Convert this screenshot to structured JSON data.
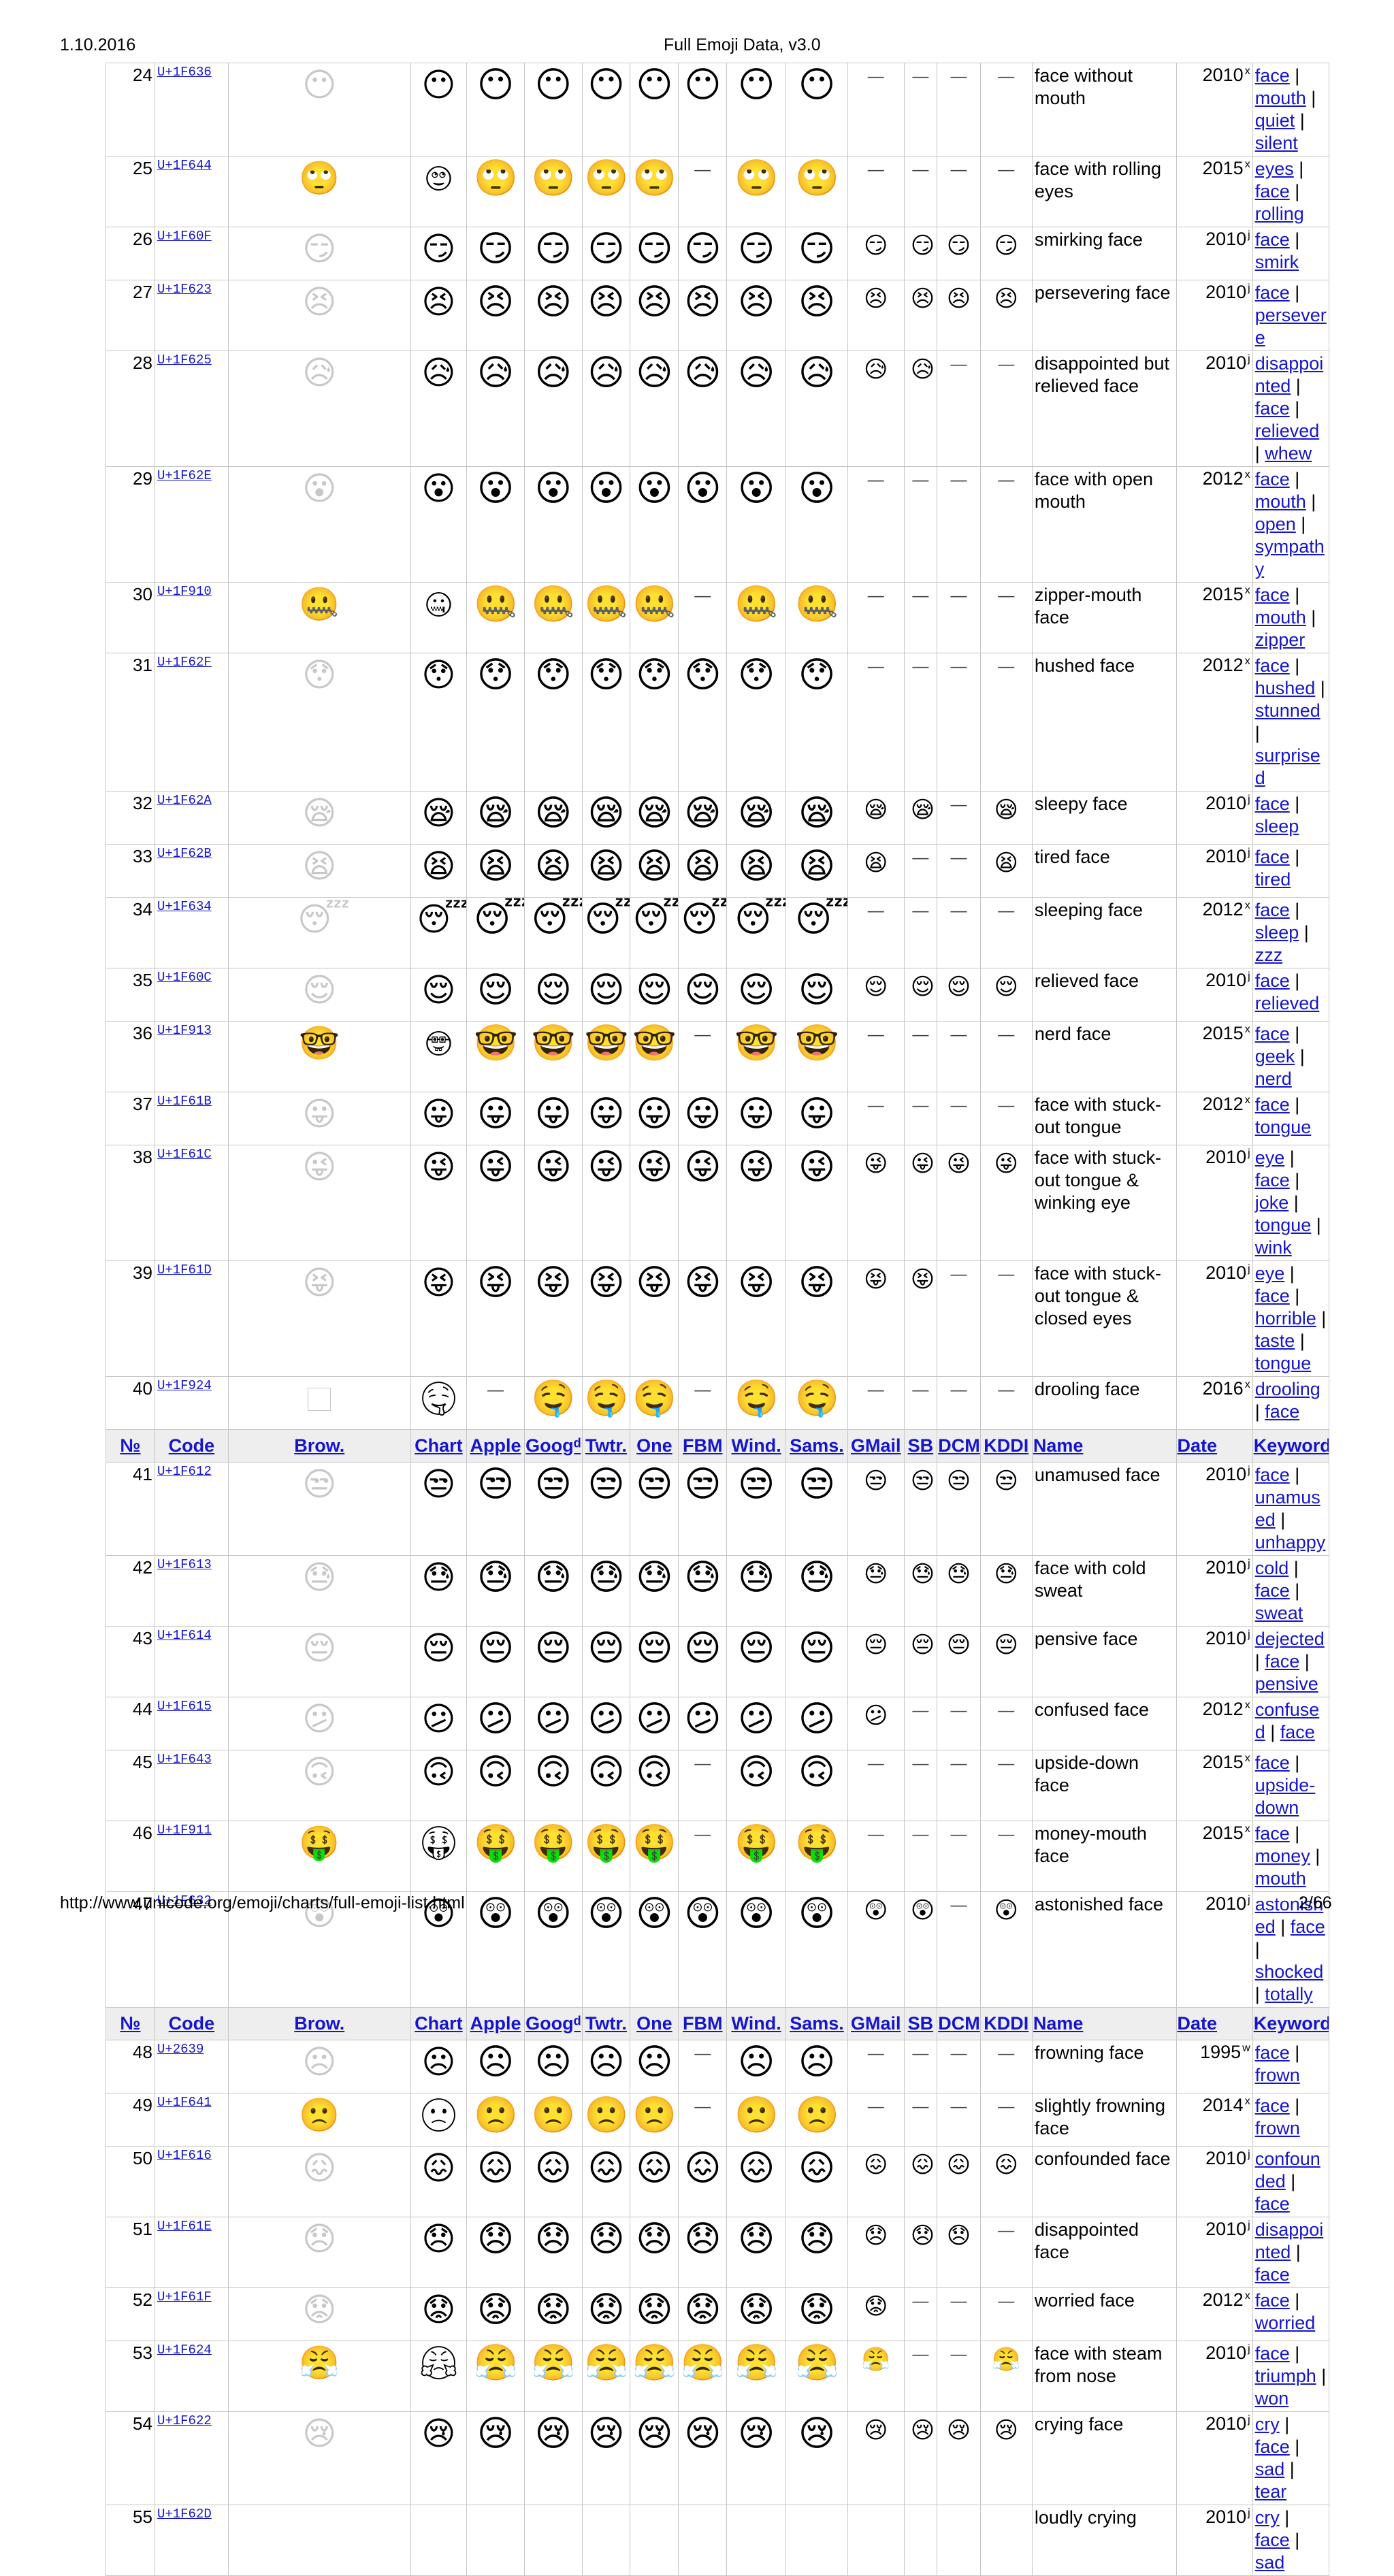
{
  "header": {
    "date": "1.10.2016",
    "title": "Full Emoji Data, v3.0"
  },
  "footer": {
    "url": "http://www.unicode.org/emoji/charts/full-emoji-list.html",
    "page": "2/66"
  },
  "columns": [
    "№",
    "Code",
    "Brow.",
    "Chart",
    "Apple",
    "Googᵈ",
    "Twtr.",
    "One",
    "FBM",
    "Wind.",
    "Sams.",
    "GMail",
    "SB",
    "DCM",
    "KDDI",
    "Name",
    "Date",
    "Keywords"
  ],
  "rows": [
    {
      "type": "emoji",
      "num": "24",
      "code": "U+1F636",
      "glyph": "😶",
      "g": [
        1,
        1,
        1,
        1,
        1,
        1,
        1,
        0,
        0,
        0,
        0
      ],
      "name": "face without mouth",
      "date": "2010",
      "dsup": "x",
      "kw": [
        "face",
        "mouth",
        "quiet",
        "silent"
      ]
    },
    {
      "type": "emoji",
      "num": "25",
      "code": "U+1F644",
      "glyph": "🙄",
      "g": [
        1,
        1,
        1,
        1,
        0,
        1,
        1,
        0,
        0,
        0,
        0
      ],
      "name": "face with rolling eyes",
      "date": "2015",
      "dsup": "x",
      "kw": [
        "eyes",
        "face",
        "rolling"
      ]
    },
    {
      "type": "emoji",
      "num": "26",
      "code": "U+1F60F",
      "glyph": "😏",
      "g": [
        1,
        1,
        1,
        1,
        1,
        1,
        1,
        1,
        1,
        1,
        1
      ],
      "name": "smirking face",
      "date": "2010",
      "dsup": "j",
      "kw": [
        "face",
        "smirk"
      ]
    },
    {
      "type": "emoji",
      "num": "27",
      "code": "U+1F623",
      "glyph": "😣",
      "g": [
        1,
        1,
        1,
        1,
        1,
        1,
        1,
        1,
        1,
        1,
        1
      ],
      "name": "persevering face",
      "date": "2010",
      "dsup": "j",
      "kw": [
        "face",
        "persevere"
      ]
    },
    {
      "type": "emoji",
      "num": "28",
      "code": "U+1F625",
      "glyph": "😥",
      "g": [
        1,
        1,
        1,
        1,
        1,
        1,
        1,
        1,
        1,
        0,
        0
      ],
      "name": "disappointed but relieved face",
      "date": "2010",
      "dsup": "j",
      "kw": [
        "disappointed",
        "face",
        "relieved",
        "whew"
      ]
    },
    {
      "type": "emoji",
      "num": "29",
      "code": "U+1F62E",
      "glyph": "😮",
      "g": [
        1,
        1,
        1,
        1,
        1,
        1,
        1,
        0,
        0,
        0,
        0
      ],
      "name": "face with open mouth",
      "date": "2012",
      "dsup": "x",
      "kw": [
        "face",
        "mouth",
        "open",
        "sympathy"
      ]
    },
    {
      "type": "emoji",
      "num": "30",
      "code": "U+1F910",
      "glyph": "🤐",
      "g": [
        1,
        1,
        1,
        1,
        0,
        1,
        1,
        0,
        0,
        0,
        0
      ],
      "name": "zipper-mouth face",
      "date": "2015",
      "dsup": "x",
      "kw": [
        "face",
        "mouth",
        "zipper"
      ]
    },
    {
      "type": "emoji",
      "num": "31",
      "code": "U+1F62F",
      "glyph": "😯",
      "g": [
        1,
        1,
        1,
        1,
        1,
        1,
        1,
        0,
        0,
        0,
        0
      ],
      "name": "hushed face",
      "date": "2012",
      "dsup": "x",
      "kw": [
        "face",
        "hushed",
        "stunned",
        "surprised"
      ]
    },
    {
      "type": "emoji",
      "num": "32",
      "code": "U+1F62A",
      "glyph": "😪",
      "g": [
        1,
        1,
        1,
        1,
        1,
        1,
        1,
        1,
        1,
        0,
        1
      ],
      "name": "sleepy face",
      "date": "2010",
      "dsup": "j",
      "kw": [
        "face",
        "sleep"
      ]
    },
    {
      "type": "emoji",
      "num": "33",
      "code": "U+1F62B",
      "glyph": "😫",
      "g": [
        1,
        1,
        1,
        1,
        1,
        1,
        1,
        1,
        0,
        0,
        1
      ],
      "name": "tired face",
      "date": "2010",
      "dsup": "j",
      "kw": [
        "face",
        "tired"
      ]
    },
    {
      "type": "emoji",
      "num": "34",
      "code": "U+1F634",
      "glyph": "😴",
      "g": [
        1,
        1,
        1,
        1,
        1,
        1,
        1,
        0,
        0,
        0,
        0
      ],
      "name": "sleeping face",
      "date": "2012",
      "dsup": "x",
      "kw": [
        "face",
        "sleep",
        "zzz"
      ]
    },
    {
      "type": "emoji",
      "num": "35",
      "code": "U+1F60C",
      "glyph": "😌",
      "g": [
        1,
        1,
        1,
        1,
        1,
        1,
        1,
        1,
        1,
        1,
        1
      ],
      "name": "relieved face",
      "date": "2010",
      "dsup": "j",
      "kw": [
        "face",
        "relieved"
      ]
    },
    {
      "type": "emoji",
      "num": "36",
      "code": "U+1F913",
      "glyph": "🤓",
      "g": [
        1,
        1,
        1,
        1,
        0,
        1,
        1,
        0,
        0,
        0,
        0
      ],
      "name": "nerd face",
      "date": "2015",
      "dsup": "x",
      "kw": [
        "face",
        "geek",
        "nerd"
      ]
    },
    {
      "type": "emoji",
      "num": "37",
      "code": "U+1F61B",
      "glyph": "😛",
      "g": [
        1,
        1,
        1,
        1,
        1,
        1,
        1,
        0,
        0,
        0,
        0
      ],
      "name": "face with stuck-out tongue",
      "date": "2012",
      "dsup": "x",
      "kw": [
        "face",
        "tongue"
      ]
    },
    {
      "type": "emoji",
      "num": "38",
      "code": "U+1F61C",
      "glyph": "😜",
      "g": [
        1,
        1,
        1,
        1,
        1,
        1,
        1,
        1,
        1,
        1,
        1
      ],
      "name": "face with stuck-out tongue & winking eye",
      "date": "2010",
      "dsup": "j",
      "kw": [
        "eye",
        "face",
        "joke",
        "tongue",
        "wink"
      ]
    },
    {
      "type": "emoji",
      "num": "39",
      "code": "U+1F61D",
      "glyph": "😝",
      "g": [
        1,
        1,
        1,
        1,
        1,
        1,
        1,
        1,
        1,
        0,
        0
      ],
      "name": "face with stuck-out tongue & closed eyes",
      "date": "2010",
      "dsup": "j",
      "kw": [
        "eye",
        "face",
        "horrible",
        "taste",
        "tongue"
      ]
    },
    {
      "type": "emoji",
      "num": "40",
      "code": "U+1F924",
      "glyph": "🤤",
      "brbox": true,
      "g": [
        0,
        1,
        1,
        1,
        0,
        1,
        1,
        0,
        0,
        0,
        0
      ],
      "name": "drooling face",
      "date": "2016",
      "dsup": "x",
      "kw": [
        "drooling",
        "face"
      ]
    },
    {
      "type": "header"
    },
    {
      "type": "emoji",
      "num": "41",
      "code": "U+1F612",
      "glyph": "😒",
      "g": [
        1,
        1,
        1,
        1,
        1,
        1,
        1,
        1,
        1,
        1,
        1
      ],
      "name": "unamused face",
      "date": "2010",
      "dsup": "j",
      "kw": [
        "face",
        "unamused",
        "unhappy"
      ]
    },
    {
      "type": "emoji",
      "num": "42",
      "code": "U+1F613",
      "glyph": "😓",
      "g": [
        1,
        1,
        1,
        1,
        1,
        1,
        1,
        1,
        1,
        1,
        1
      ],
      "name": "face with cold sweat",
      "date": "2010",
      "dsup": "j",
      "kw": [
        "cold",
        "face",
        "sweat"
      ]
    },
    {
      "type": "emoji",
      "num": "43",
      "code": "U+1F614",
      "glyph": "😔",
      "g": [
        1,
        1,
        1,
        1,
        1,
        1,
        1,
        1,
        1,
        1,
        1
      ],
      "name": "pensive face",
      "date": "2010",
      "dsup": "j",
      "kw": [
        "dejected",
        "face",
        "pensive"
      ]
    },
    {
      "type": "emoji",
      "num": "44",
      "code": "U+1F615",
      "glyph": "😕",
      "g": [
        1,
        1,
        1,
        1,
        1,
        1,
        1,
        1,
        0,
        0,
        0
      ],
      "name": "confused face",
      "date": "2012",
      "dsup": "x",
      "kw": [
        "confused",
        "face"
      ]
    },
    {
      "type": "emoji",
      "num": "45",
      "code": "U+1F643",
      "glyph": "🙃",
      "g": [
        1,
        1,
        1,
        1,
        0,
        1,
        1,
        0,
        0,
        0,
        0
      ],
      "name": "upside-down face",
      "date": "2015",
      "dsup": "x",
      "kw": [
        "face",
        "upside-down"
      ]
    },
    {
      "type": "emoji",
      "num": "46",
      "code": "U+1F911",
      "glyph": "🤑",
      "g": [
        1,
        1,
        1,
        1,
        0,
        1,
        1,
        0,
        0,
        0,
        0
      ],
      "name": "money-mouth face",
      "date": "2015",
      "dsup": "x",
      "kw": [
        "face",
        "money",
        "mouth"
      ]
    },
    {
      "type": "emoji",
      "num": "47",
      "code": "U+1F632",
      "glyph": "😲",
      "g": [
        1,
        1,
        1,
        1,
        1,
        1,
        1,
        1,
        1,
        0,
        1
      ],
      "name": "astonished face",
      "date": "2010",
      "dsup": "j",
      "kw": [
        "astonished",
        "face",
        "shocked",
        "totally"
      ]
    },
    {
      "type": "header"
    },
    {
      "type": "emoji",
      "num": "48",
      "code": "U+2639",
      "glyph": "☹",
      "g": [
        1,
        1,
        1,
        1,
        0,
        1,
        1,
        0,
        0,
        0,
        0
      ],
      "name": "frowning face",
      "date": "1995",
      "dsup": "w",
      "kw": [
        "face",
        "frown"
      ]
    },
    {
      "type": "emoji",
      "num": "49",
      "code": "U+1F641",
      "glyph": "🙁",
      "g": [
        1,
        1,
        1,
        1,
        0,
        1,
        1,
        0,
        0,
        0,
        0
      ],
      "name": "slightly frowning face",
      "date": "2014",
      "dsup": "x",
      "kw": [
        "face",
        "frown"
      ]
    },
    {
      "type": "emoji",
      "num": "50",
      "code": "U+1F616",
      "glyph": "😖",
      "g": [
        1,
        1,
        1,
        1,
        1,
        1,
        1,
        1,
        1,
        1,
        1
      ],
      "name": "confounded face",
      "date": "2010",
      "dsup": "j",
      "kw": [
        "confounded",
        "face"
      ]
    },
    {
      "type": "emoji",
      "num": "51",
      "code": "U+1F61E",
      "glyph": "😞",
      "g": [
        1,
        1,
        1,
        1,
        1,
        1,
        1,
        1,
        1,
        1,
        0
      ],
      "name": "disappointed face",
      "date": "2010",
      "dsup": "j",
      "kw": [
        "disappointed",
        "face"
      ]
    },
    {
      "type": "emoji",
      "num": "52",
      "code": "U+1F61F",
      "glyph": "😟",
      "g": [
        1,
        1,
        1,
        1,
        1,
        1,
        1,
        1,
        0,
        0,
        0
      ],
      "name": "worried face",
      "date": "2012",
      "dsup": "x",
      "kw": [
        "face",
        "worried"
      ]
    },
    {
      "type": "emoji",
      "num": "53",
      "code": "U+1F624",
      "glyph": "😤",
      "g": [
        1,
        1,
        1,
        1,
        1,
        1,
        1,
        1,
        0,
        0,
        1
      ],
      "name": "face with steam from nose",
      "date": "2010",
      "dsup": "j",
      "kw": [
        "face",
        "triumph",
        "won"
      ]
    },
    {
      "type": "emoji",
      "num": "54",
      "code": "U+1F622",
      "glyph": "😢",
      "g": [
        1,
        1,
        1,
        1,
        1,
        1,
        1,
        1,
        1,
        1,
        1
      ],
      "name": "crying face",
      "date": "2010",
      "dsup": "j",
      "kw": [
        "cry",
        "face",
        "sad",
        "tear"
      ]
    },
    {
      "type": "emoji",
      "num": "55",
      "code": "U+1F62D",
      "glyph": "",
      "partial": true,
      "g": [
        0,
        0,
        0,
        0,
        0,
        0,
        0,
        0,
        0,
        0,
        0
      ],
      "name": "loudly crying",
      "date": "2010",
      "dsup": "j",
      "kw": [
        "cry",
        "face",
        "sad"
      ]
    }
  ]
}
